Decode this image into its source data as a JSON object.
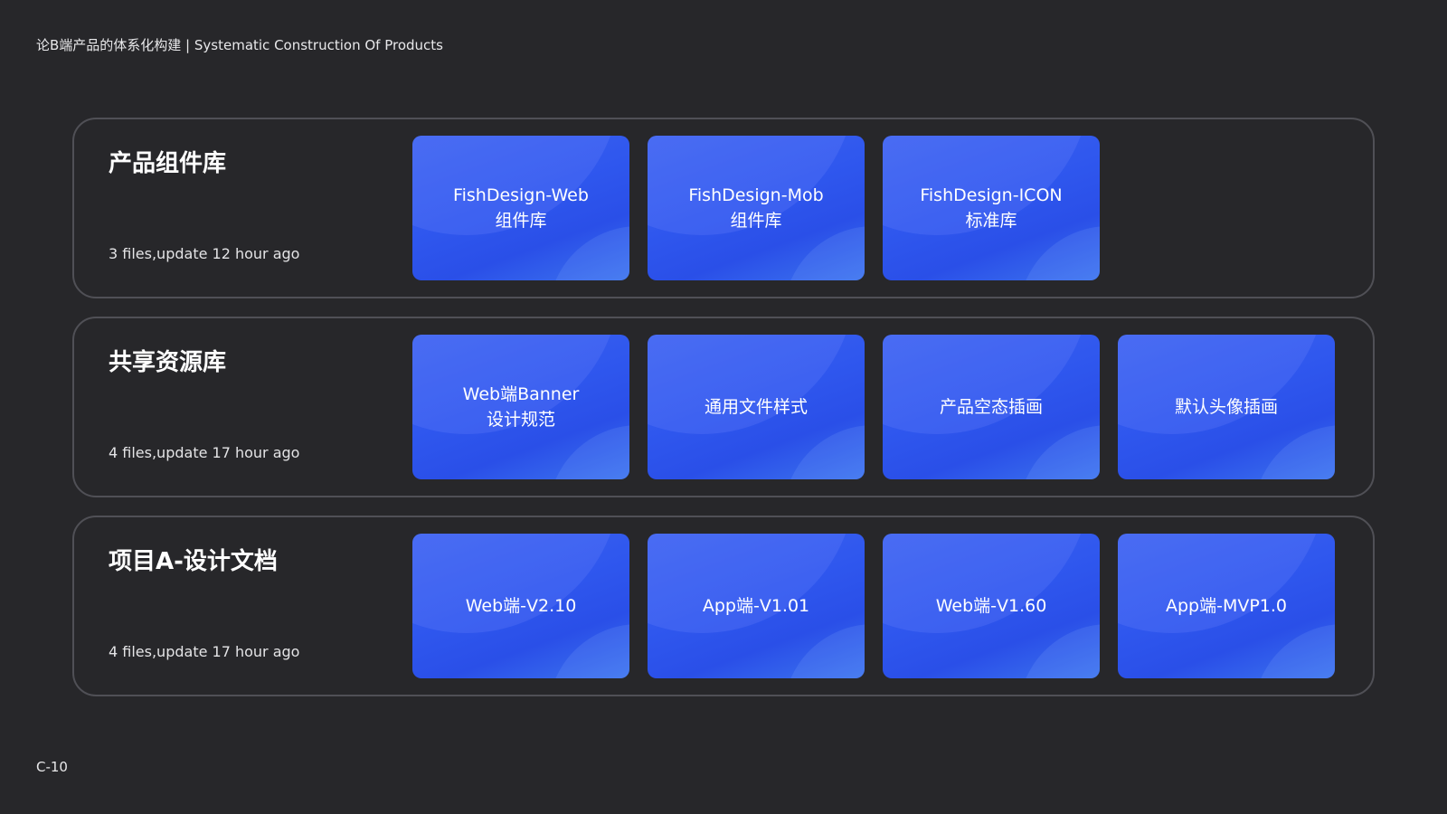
{
  "header": {
    "title": "论B端产品的体系化构建 | Systematic Construction Of Products"
  },
  "footer": {
    "page_number": "C-10"
  },
  "colors": {
    "background": "#27272a",
    "section_border": "#505056",
    "card_primary": "#2f57ee",
    "card_highlight": "#3c73ee"
  },
  "sections": [
    {
      "title": "产品组件库",
      "meta": "3 files,update 12 hour ago",
      "cards": [
        {
          "line1": "FishDesign-Web",
          "line2": "组件库"
        },
        {
          "line1": "FishDesign-Mob",
          "line2": "组件库"
        },
        {
          "line1": "FishDesign-ICON",
          "line2": "标准库"
        }
      ]
    },
    {
      "title": "共享资源库",
      "meta": "4 files,update 17 hour ago",
      "cards": [
        {
          "line1": "Web端Banner",
          "line2": "设计规范"
        },
        {
          "line1": "通用文件样式",
          "line2": ""
        },
        {
          "line1": "产品空态插画",
          "line2": ""
        },
        {
          "line1": "默认头像插画",
          "line2": ""
        }
      ]
    },
    {
      "title": "项目A-设计文档",
      "meta": "4 files,update 17 hour ago",
      "cards": [
        {
          "line1": "Web端-V2.10",
          "line2": ""
        },
        {
          "line1": "App端-V1.01",
          "line2": ""
        },
        {
          "line1": "Web端-V1.60",
          "line2": ""
        },
        {
          "line1": "App端-MVP1.0",
          "line2": ""
        }
      ]
    }
  ]
}
